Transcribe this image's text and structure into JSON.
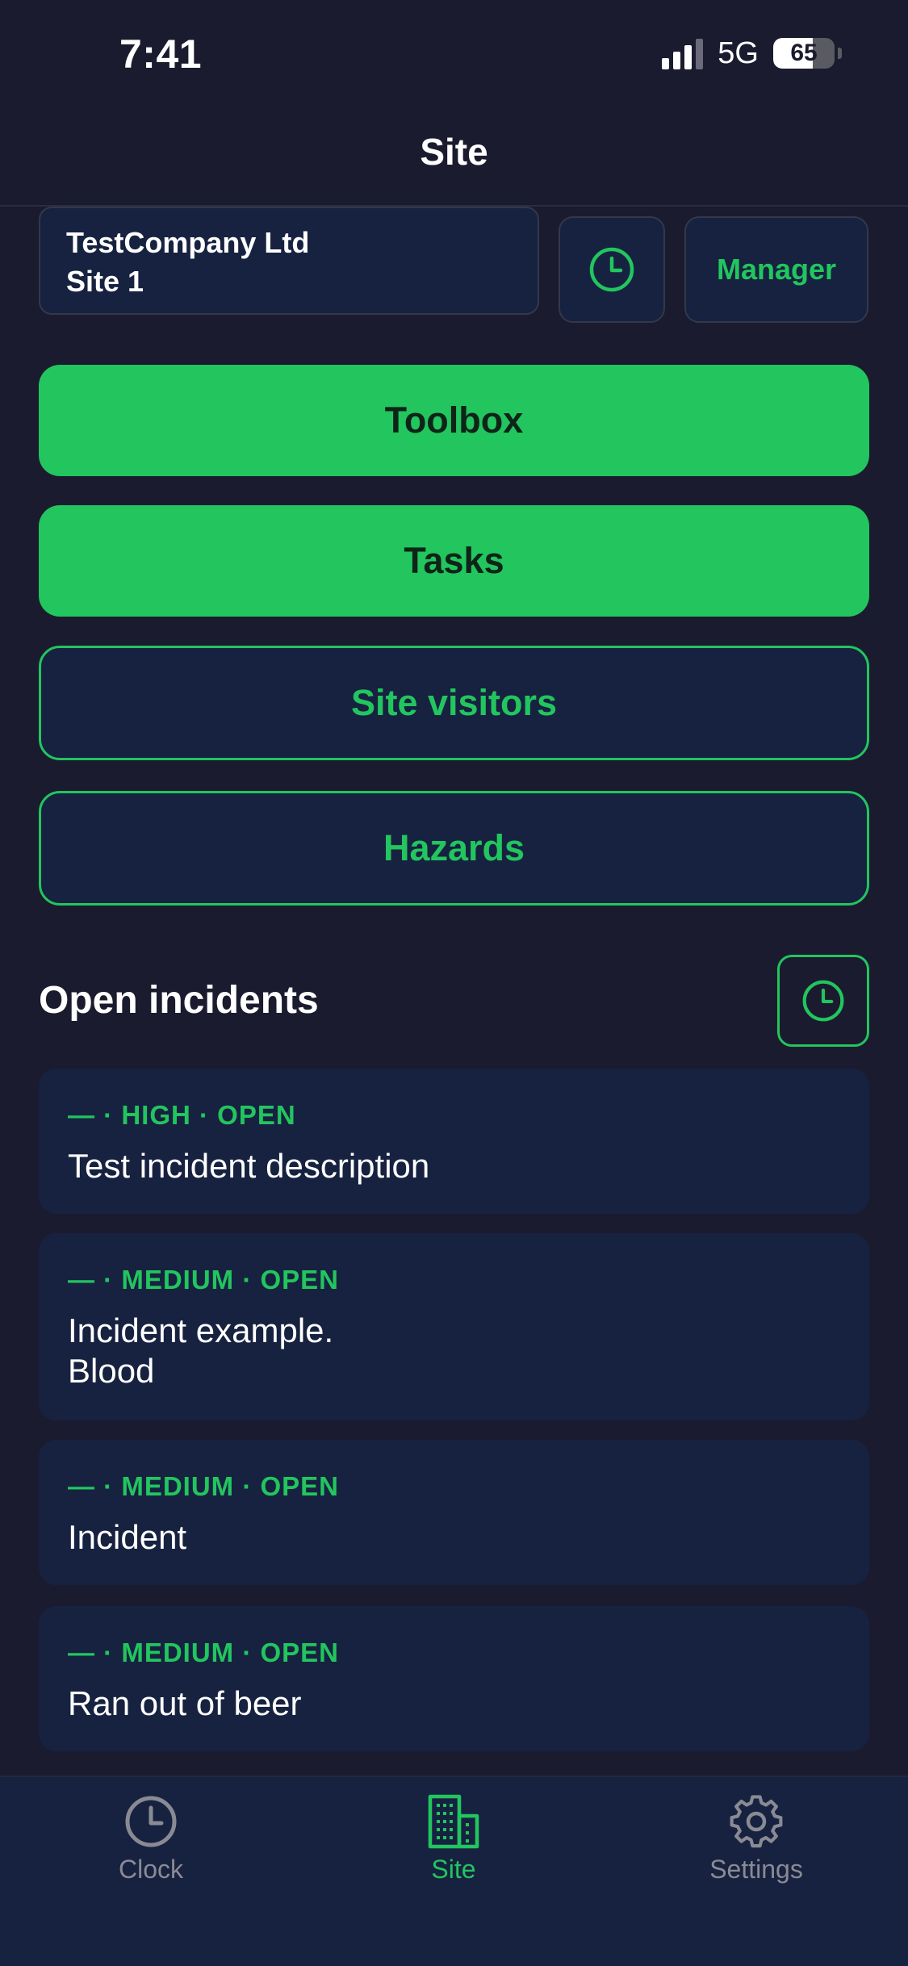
{
  "status_bar": {
    "time": "7:41",
    "network": "5G",
    "battery": "65",
    "battery_level": 0.65
  },
  "header": {
    "title": "Site"
  },
  "site": {
    "company": "TestCompany Ltd",
    "name": "Site 1",
    "role_button": "Manager"
  },
  "actions": [
    {
      "label": "Toolbox",
      "style": "filled"
    },
    {
      "label": "Tasks",
      "style": "filled"
    },
    {
      "label": "Site visitors",
      "style": "outline"
    },
    {
      "label": "Hazards",
      "style": "outline"
    }
  ],
  "incidents_section": {
    "title": "Open incidents",
    "items": [
      {
        "meta": "— · HIGH · OPEN",
        "description": "Test incident description"
      },
      {
        "meta": "— · MEDIUM · OPEN",
        "description": "Incident example.\nBlood"
      },
      {
        "meta": "— · MEDIUM · OPEN",
        "description": "Incident"
      },
      {
        "meta": "— · MEDIUM · OPEN",
        "description": "Ran out of beer"
      }
    ]
  },
  "tab_bar": {
    "tabs": [
      {
        "label": "Clock",
        "icon": "clock-icon",
        "active": false
      },
      {
        "label": "Site",
        "icon": "building-icon",
        "active": true
      },
      {
        "label": "Settings",
        "icon": "gear-icon",
        "active": false
      }
    ]
  },
  "colors": {
    "accent": "#22c55e",
    "background": "#1b1b2f",
    "card": "#172240",
    "muted": "#8a8a94"
  }
}
